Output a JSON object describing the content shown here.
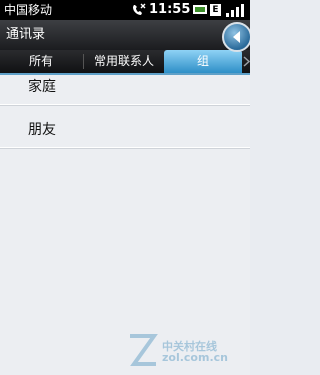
{
  "status_bar": {
    "carrier": "中国移动",
    "time": "11:55",
    "network_badge": "E"
  },
  "header": {
    "title": "通讯录"
  },
  "tabs": [
    {
      "label": "所有",
      "active": false
    },
    {
      "label": "常用联系人",
      "active": false
    },
    {
      "label": "组",
      "active": true
    }
  ],
  "groups": [
    {
      "label": "家庭"
    },
    {
      "label": "朋友"
    }
  ],
  "watermark": {
    "name": "中关村在线",
    "domain": "zol.com.cn"
  },
  "colors": {
    "accent": "#3a9ad4",
    "background": "#eceef2",
    "bar": "#1b1c1f"
  }
}
